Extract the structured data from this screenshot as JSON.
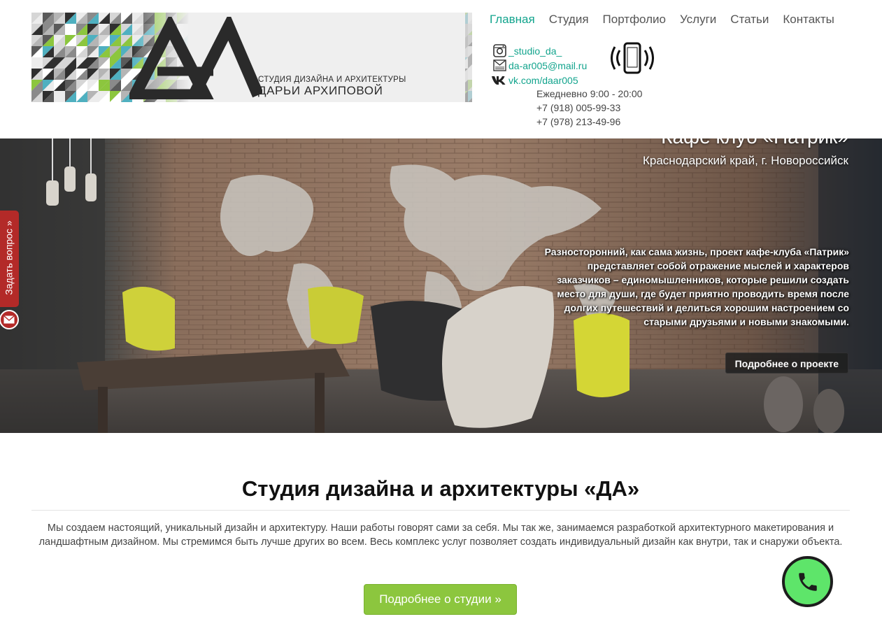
{
  "logo": {
    "mark": "ДА",
    "subtitle": "СТУДИЯ ДИЗАЙНА И АРХИТЕКТУРЫ",
    "name": "ДАРЬИ АРХИПОВОЙ"
  },
  "nav": {
    "items": [
      {
        "label": "Главная",
        "active": true
      },
      {
        "label": "Студия",
        "active": false
      },
      {
        "label": "Портфолио",
        "active": false
      },
      {
        "label": "Услуги",
        "active": false
      },
      {
        "label": "Статьи",
        "active": false
      },
      {
        "label": "Контакты",
        "active": false
      }
    ]
  },
  "contacts": {
    "instagram": "_studio_da_",
    "email": "da-ar005@mail.ru",
    "vk": "vk.com/daar005",
    "hours": "Ежедневно 9:00 - 20:00",
    "phone1": "+7 (918) 005-99-33",
    "phone2": "+7 (978) 213-49-96"
  },
  "hero": {
    "title": "Кафе клуб «Патрик»",
    "location": "Краснодарский край, г. Новороссийск",
    "description": "Разносторонний, как сама жизнь, проект кафе-клуба «Патрик» представляет собой отражение мыслей и характеров заказчиков – единомышленников, которые решили создать место для души, где будет приятно проводить время после долгих путешествий и делиться хорошим настроением со старыми друзьями и новыми знакомыми.",
    "button": "Подробнее о проекте"
  },
  "side_tab": {
    "label": "Задать вопрос »"
  },
  "about": {
    "title": "Студия дизайна и архитектуры «ДА»",
    "text": "Мы создаем настоящий, уникальный дизайн и архитектуру. Наши работы говорят сами за себя. Мы так же, занимаемся разработкой архитектурного макетирования и ландшафтным дизайном. Мы стремимся быть лучше других во всем. Весь комплекс услуг позволяет создать индивидуальный дизайн как внутри, так и снаружи объекта.",
    "button": "Подробнее о студии »"
  },
  "colors": {
    "accent": "#12a48d",
    "cta_green": "#8cc63e",
    "side_tab_red": "#b32a28",
    "callback_green": "#5ee56a"
  },
  "icons": [
    "instagram-icon",
    "mail-icon",
    "vk-icon",
    "phone-ringing-icon",
    "envelope-icon",
    "handset-icon"
  ]
}
